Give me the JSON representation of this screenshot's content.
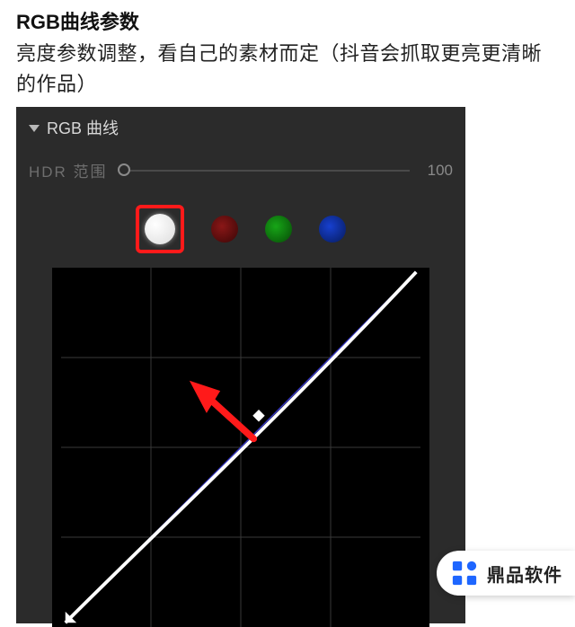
{
  "article": {
    "title": "RGB曲线参数",
    "description": "亮度参数调整，看自己的素材而定（抖音会抓取更亮更清晰的作品）"
  },
  "panel": {
    "title": "RGB 曲线",
    "hdr_label": "HDR 范围",
    "hdr_value": "100",
    "slider_position": 0,
    "channels": {
      "white": "rgb-luma-channel",
      "red": "red-channel",
      "green": "green-channel",
      "blue": "blue-channel",
      "selected": "white"
    }
  },
  "chart_data": {
    "type": "line",
    "title": "RGB 曲线",
    "xlabel": "",
    "ylabel": "",
    "xlim": [
      0,
      1
    ],
    "ylim": [
      0,
      1
    ],
    "grid": true,
    "series": [
      {
        "name": "reference-linear",
        "color": "#3a3aff",
        "x": [
          0,
          1
        ],
        "y": [
          0,
          1
        ]
      },
      {
        "name": "rgb-curve",
        "color": "#ffffff",
        "x": [
          0.0,
          0.1,
          0.2,
          0.3,
          0.4,
          0.5,
          0.6,
          0.7,
          0.8,
          0.9,
          1.0
        ],
        "y": [
          0.0,
          0.14,
          0.27,
          0.4,
          0.51,
          0.61,
          0.71,
          0.8,
          0.88,
          0.95,
          1.0
        ],
        "control_point": {
          "x": 0.55,
          "y": 0.66
        }
      }
    ],
    "annotations": [
      {
        "type": "arrow",
        "from": {
          "x": 0.55,
          "y": 0.55
        },
        "to": {
          "x": 0.4,
          "y": 0.72
        },
        "color": "#ff1a1a"
      }
    ]
  },
  "watermark": {
    "text": "鼎品软件",
    "logo_name": "dingpin-logo"
  }
}
